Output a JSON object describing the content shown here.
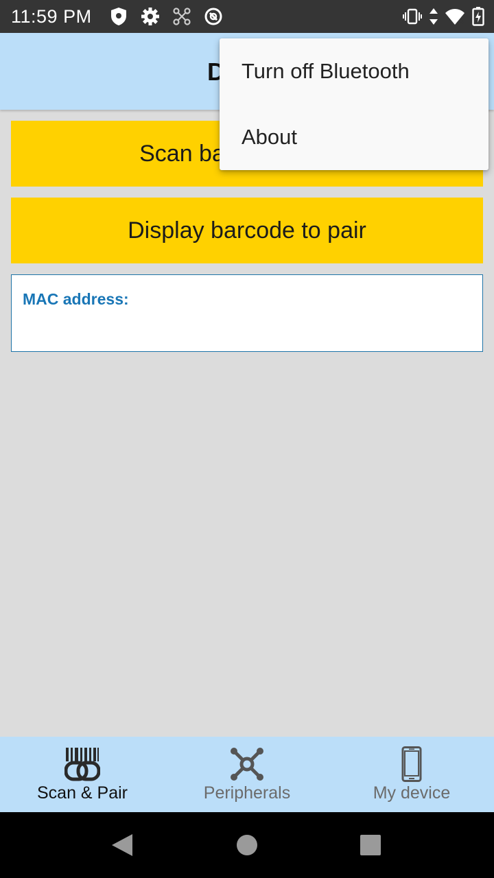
{
  "status_bar": {
    "time": "11:59 PM",
    "left_icons": [
      "shield-icon",
      "gear-icon",
      "network-icon",
      "sync-icon"
    ],
    "right_icons": [
      "vibrate-icon",
      "data-arrows-icon",
      "wifi-icon",
      "battery-charging-icon"
    ]
  },
  "app_bar": {
    "title": "Device"
  },
  "buttons": {
    "scan": "Scan barcode to pair",
    "display": "Display barcode to pair"
  },
  "mac": {
    "label": "MAC address:",
    "value": ""
  },
  "overflow_menu": {
    "items": [
      "Turn off Bluetooth",
      "About"
    ]
  },
  "bottom_nav": {
    "items": [
      {
        "label": "Scan & Pair",
        "icon": "barcode-link-icon",
        "active": true
      },
      {
        "label": "Peripherals",
        "icon": "peripherals-icon",
        "active": false
      },
      {
        "label": "My device",
        "icon": "phone-icon",
        "active": false
      }
    ]
  },
  "colors": {
    "app_bar": "#bbdef9",
    "button": "#ffd100",
    "mac_label": "#1976b6",
    "status_bar": "#353535",
    "background": "#dcdcdc"
  }
}
